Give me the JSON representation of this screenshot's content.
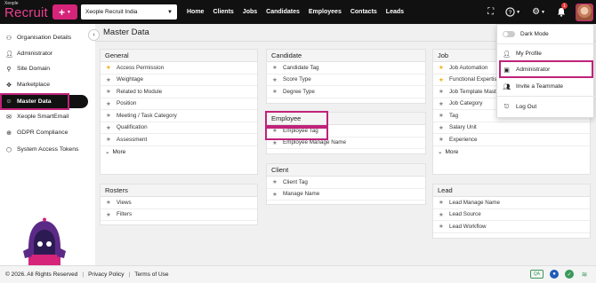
{
  "colors": {
    "accent": "#d6247b",
    "highlight": "#c0227a",
    "topbar": "#111111",
    "star_on": "#f3b11b"
  },
  "topbar": {
    "logo_small": "Xeople",
    "logo_big": "Recruit",
    "plus_icon": "plus-icon",
    "account_selected": "Xeople Recruit India",
    "nav": [
      "Home",
      "Clients",
      "Jobs",
      "Candidates",
      "Employees",
      "Contacts",
      "Leads"
    ],
    "notification_count": "1"
  },
  "sidebar": {
    "items": [
      {
        "label": "Organisation Details",
        "icon": "org-icon"
      },
      {
        "label": "Administrator",
        "icon": "user-icon"
      },
      {
        "label": "Site Domain",
        "icon": "domain-icon"
      },
      {
        "label": "Marketplace",
        "icon": "marketplace-icon"
      },
      {
        "label": "Master Data",
        "icon": "data-icon"
      },
      {
        "label": "Xeople SmartEmail",
        "icon": "email-icon"
      },
      {
        "label": "GDPR Compliance",
        "icon": "gdpr-icon"
      },
      {
        "label": "System Access Tokens",
        "icon": "token-icon"
      }
    ]
  },
  "main": {
    "title": "Master Data",
    "cards": {
      "general": {
        "title": "General",
        "rows": [
          {
            "label": "Access Permission",
            "starred": true
          },
          {
            "label": "Weightage",
            "starred": false
          },
          {
            "label": "Related to Module",
            "starred": false
          },
          {
            "label": "Position",
            "starred": false
          },
          {
            "label": "Meeting / Task Category",
            "starred": false
          },
          {
            "label": "Qualification",
            "starred": false
          },
          {
            "label": "Assessment",
            "starred": false
          }
        ],
        "more": "More"
      },
      "rosters": {
        "title": "Rosters",
        "rows": [
          {
            "label": "Views",
            "starred": false
          },
          {
            "label": "Filters",
            "starred": false
          }
        ]
      },
      "candidate": {
        "title": "Candidate",
        "rows": [
          {
            "label": "Candidate Tag",
            "starred": false
          },
          {
            "label": "Score Type",
            "starred": false
          },
          {
            "label": "Degree Type",
            "starred": false
          }
        ]
      },
      "employee": {
        "title": "Employee",
        "rows": [
          {
            "label": "Employee Tag",
            "starred": false
          },
          {
            "label": "Employee Manage Name",
            "starred": false
          }
        ]
      },
      "client": {
        "title": "Client",
        "rows": [
          {
            "label": "Client Tag",
            "starred": false
          },
          {
            "label": "Manage Name",
            "starred": false
          }
        ]
      },
      "job": {
        "title": "Job",
        "rows": [
          {
            "label": "Job Automation",
            "starred": true
          },
          {
            "label": "Functional Expertise",
            "starred": true
          },
          {
            "label": "Job Template Master",
            "starred": false
          },
          {
            "label": "Job Category",
            "starred": false
          },
          {
            "label": "Tag",
            "starred": false
          },
          {
            "label": "Salary Unit",
            "starred": false
          },
          {
            "label": "Experience",
            "starred": false
          }
        ],
        "more": "More"
      },
      "lead": {
        "title": "Lead",
        "rows": [
          {
            "label": "Lead Manage Name",
            "starred": false
          },
          {
            "label": "Lead Source",
            "starred": false
          },
          {
            "label": "Lead Workflow",
            "starred": false
          }
        ]
      }
    }
  },
  "dropdown": {
    "items": [
      {
        "label": "Dark Mode",
        "icon": "toggle-icon"
      },
      {
        "label": "My Profile",
        "icon": "user-icon"
      },
      {
        "label": "Administrator",
        "icon": "admin-icon"
      },
      {
        "label": "Invite a Teammate",
        "icon": "invite-icon"
      },
      {
        "label": "Log Out",
        "icon": "logout-icon"
      }
    ]
  },
  "footer": {
    "copyright": "© 2026. All Rights Reserved",
    "privacy": "Privacy Policy",
    "terms": "Terms of Use",
    "qa": "QA"
  }
}
